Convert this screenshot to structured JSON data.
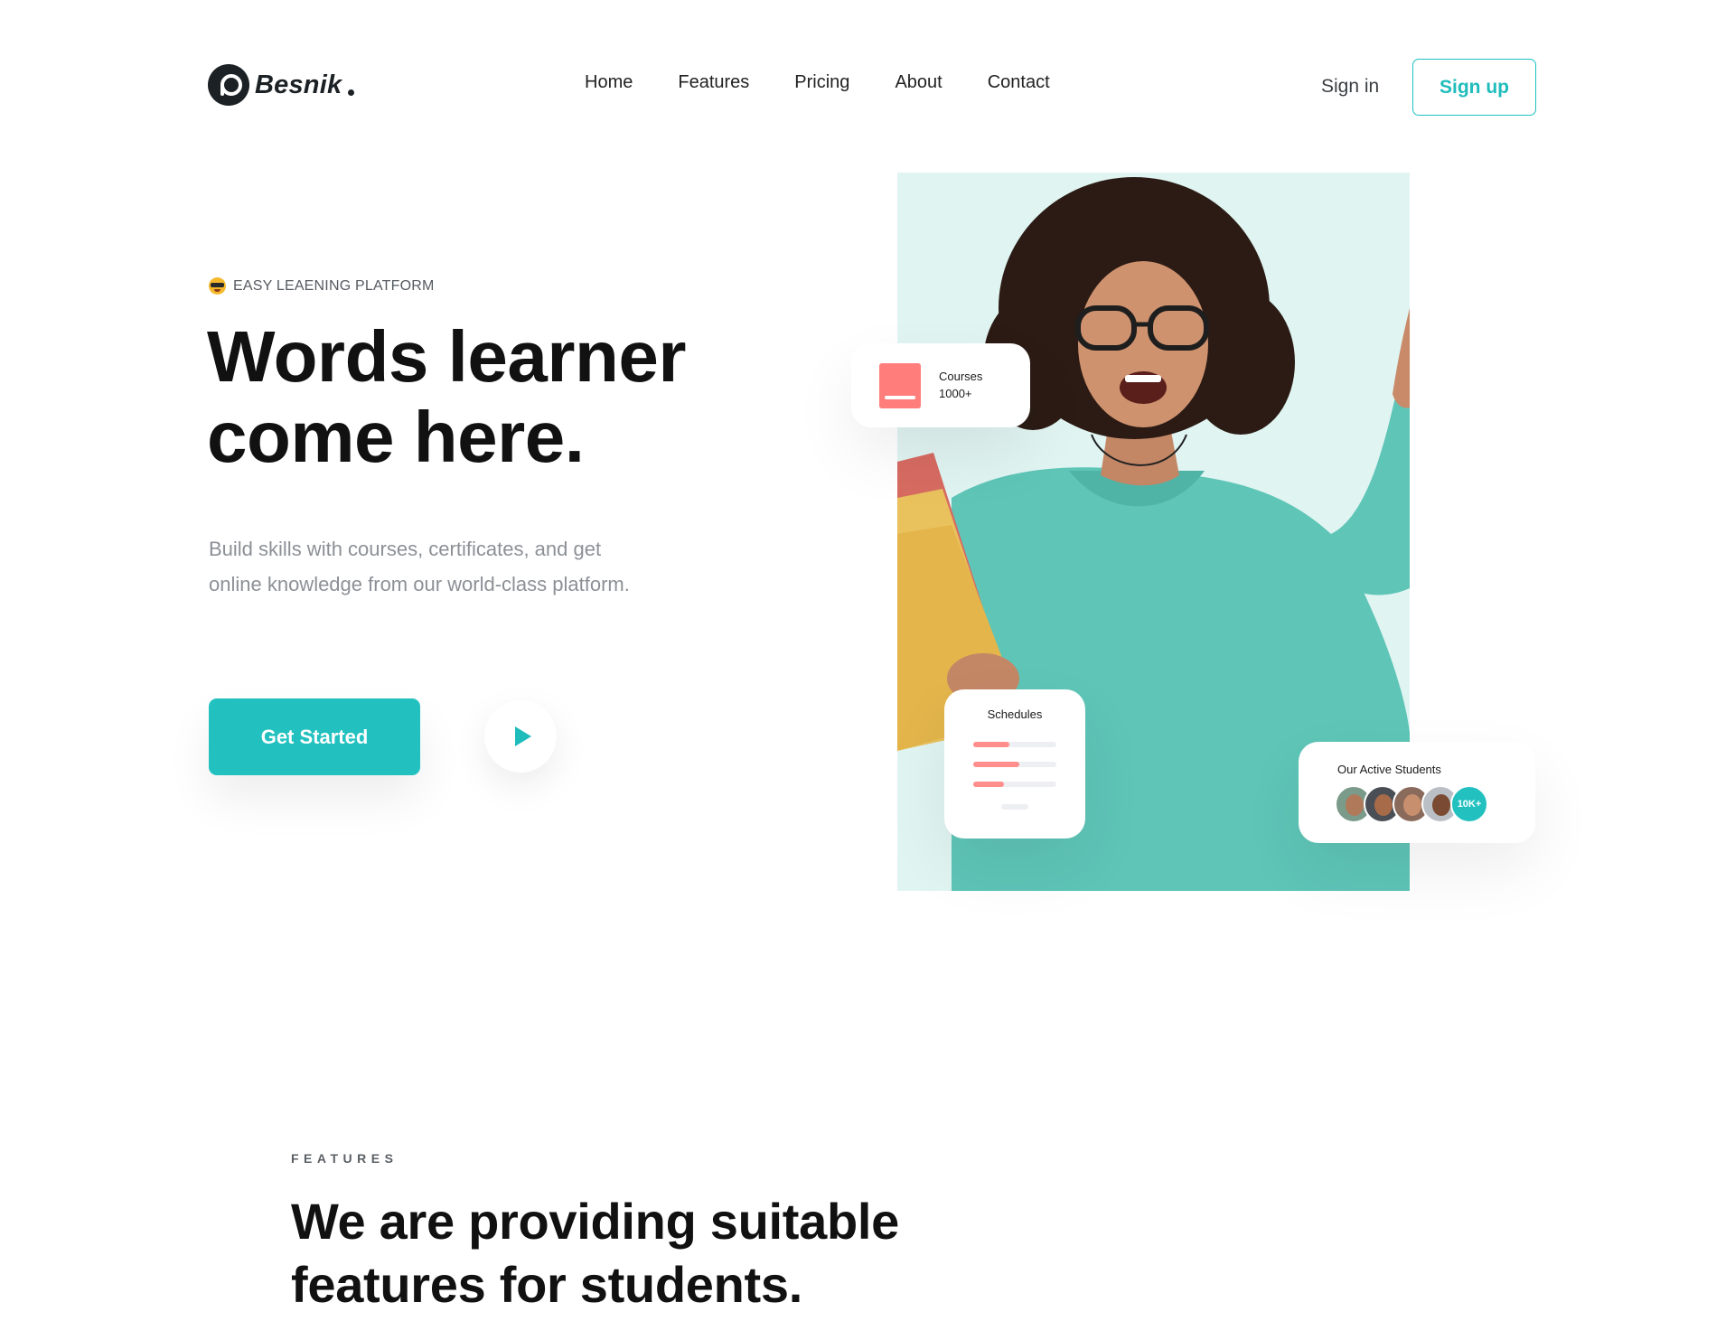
{
  "header": {
    "brand": "Besnik",
    "nav": [
      "Home",
      "Features",
      "Pricing",
      "About",
      "Contact"
    ],
    "sign_in": "Sign in",
    "sign_up": "Sign up"
  },
  "hero": {
    "eyebrow": "EASY LEAENING PLATFORM",
    "title_line1": "Words learner",
    "title_line2": "come here.",
    "description": "Build skills with courses, certificates, and get online knowledge from our world-class platform.",
    "cta": "Get Started"
  },
  "cards": {
    "courses": {
      "label": "Courses",
      "count": "1000+"
    },
    "schedules": {
      "label": "Schedules",
      "bar_fill_fractions": [
        0.43,
        0.55,
        0.37
      ]
    },
    "students": {
      "label": "Our Active Students",
      "count": "10K+"
    }
  },
  "features": {
    "eyebrow": "FEATURES",
    "title_line1": "We are providing suitable",
    "title_line2": "features for students."
  },
  "colors": {
    "accent": "#22c1c0",
    "coral": "#ff7d7b",
    "photo_bg": "#e0f4f2",
    "dark": "#1b2124"
  }
}
